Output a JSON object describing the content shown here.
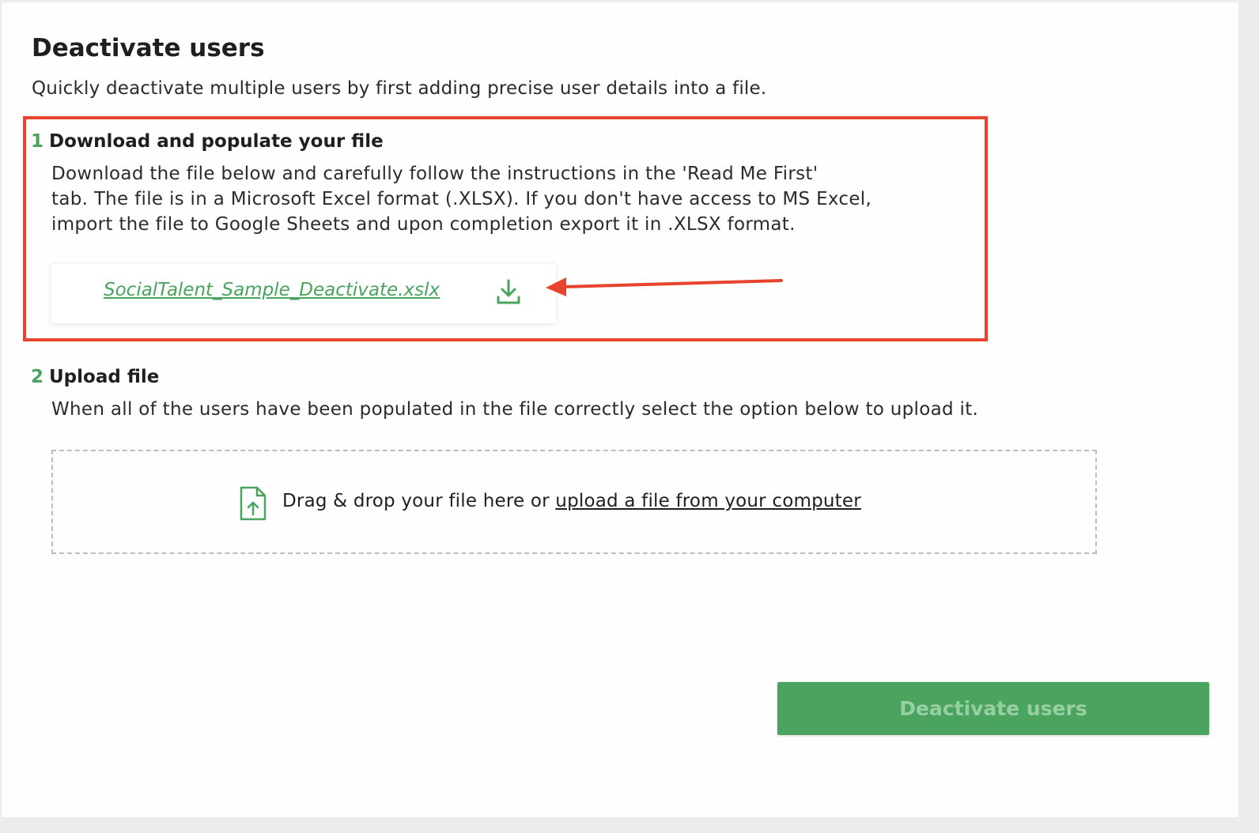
{
  "page": {
    "title": "Deactivate users",
    "subtitle": "Quickly deactivate multiple users by first adding precise user details into a file."
  },
  "step1": {
    "number": "1",
    "heading": "Download and populate your file",
    "body_lines": [
      "Download the file below and carefully follow the instructions in the 'Read Me First'",
      "tab. The file is in a Microsoft Excel format (.XLSX). If you don't have access to MS Excel,",
      "import the file to Google Sheets and upon completion export it in .XLSX format."
    ],
    "file_name": "SocialTalent_Sample_Deactivate.xslx",
    "download_icon": "download-icon"
  },
  "step2": {
    "number": "2",
    "heading": "Upload file",
    "body": "When all of the users have been populated in the file correctly select the option below to upload it.",
    "dropzone": {
      "icon": "file-upload-icon",
      "text": "Drag & drop your file here or ",
      "link": "upload a file from your computer"
    }
  },
  "actions": {
    "deactivate_label": "Deactivate users"
  },
  "colors": {
    "accent": "#4aa35f",
    "annotation": "#e8432d",
    "button_text": "#97cfa3"
  }
}
